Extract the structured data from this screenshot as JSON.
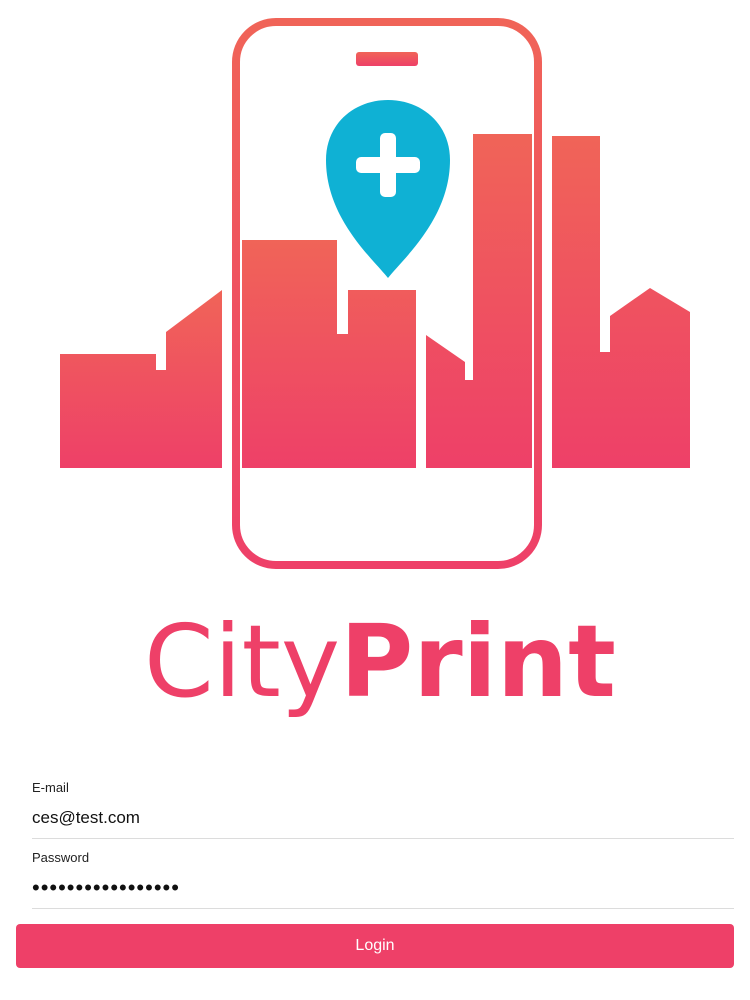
{
  "brand": {
    "name_part1": "City",
    "name_part2": "Print",
    "logo_icon": "city-phone-map-pin-icon",
    "colors": {
      "primary": "#ee4068",
      "primary_top": "#f06458",
      "pin": "#0fb1d4",
      "white": "#ffffff"
    }
  },
  "form": {
    "email_label": "E-mail",
    "email_value": "ces@test.com",
    "password_label": "Password",
    "password_value": "•••••••••••••••••",
    "login_label": "Login"
  }
}
